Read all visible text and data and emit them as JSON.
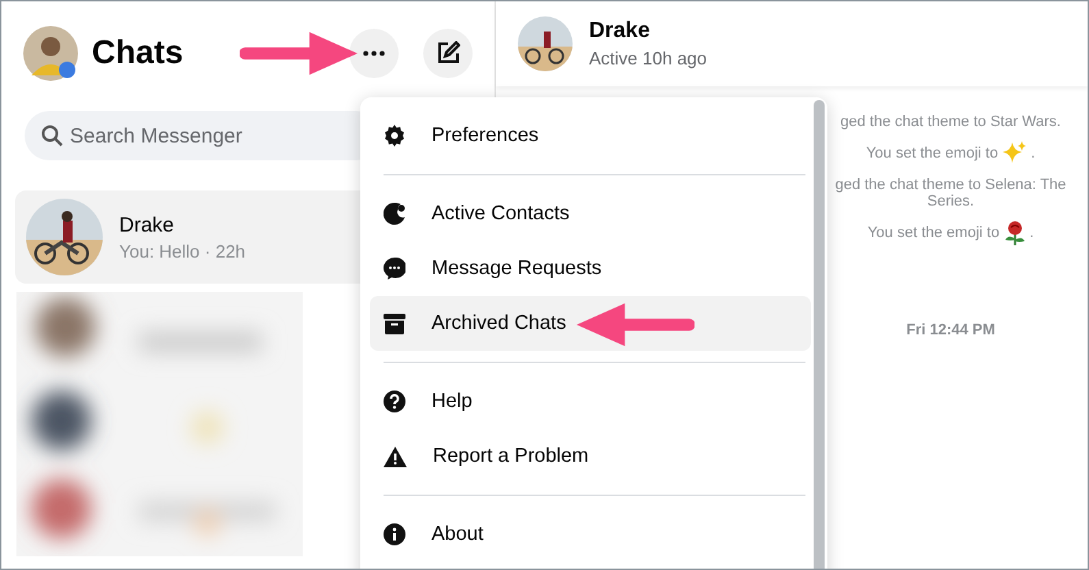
{
  "sidebar": {
    "title": "Chats",
    "search": {
      "placeholder": "Search Messenger"
    },
    "chats": [
      {
        "name": "Drake",
        "preview": "You: Hello · 22h",
        "selected": true
      }
    ]
  },
  "conversation": {
    "name": "Drake",
    "status": "Active 10h ago",
    "messages": [
      {
        "kind": "text",
        "text": "ged the chat theme to Star Wars."
      },
      {
        "kind": "sparkles",
        "text": "You set the emoji to",
        "end": "."
      },
      {
        "kind": "text",
        "text": "ged the chat theme to Selena: The Series."
      },
      {
        "kind": "rose",
        "text": "You set the emoji to",
        "end": "."
      },
      {
        "kind": "time",
        "text": "Fri 12:44 PM"
      }
    ]
  },
  "menu": {
    "sections": [
      [
        {
          "label": "Preferences",
          "selected": false
        }
      ],
      [
        {
          "label": "Active Contacts",
          "selected": false
        },
        {
          "label": "Message Requests",
          "selected": false
        },
        {
          "label": "Archived Chats",
          "selected": true
        }
      ],
      [
        {
          "label": "Help",
          "selected": false
        },
        {
          "label": "Report a Problem",
          "selected": false
        }
      ],
      [
        {
          "label": "About",
          "selected": false
        }
      ]
    ]
  }
}
